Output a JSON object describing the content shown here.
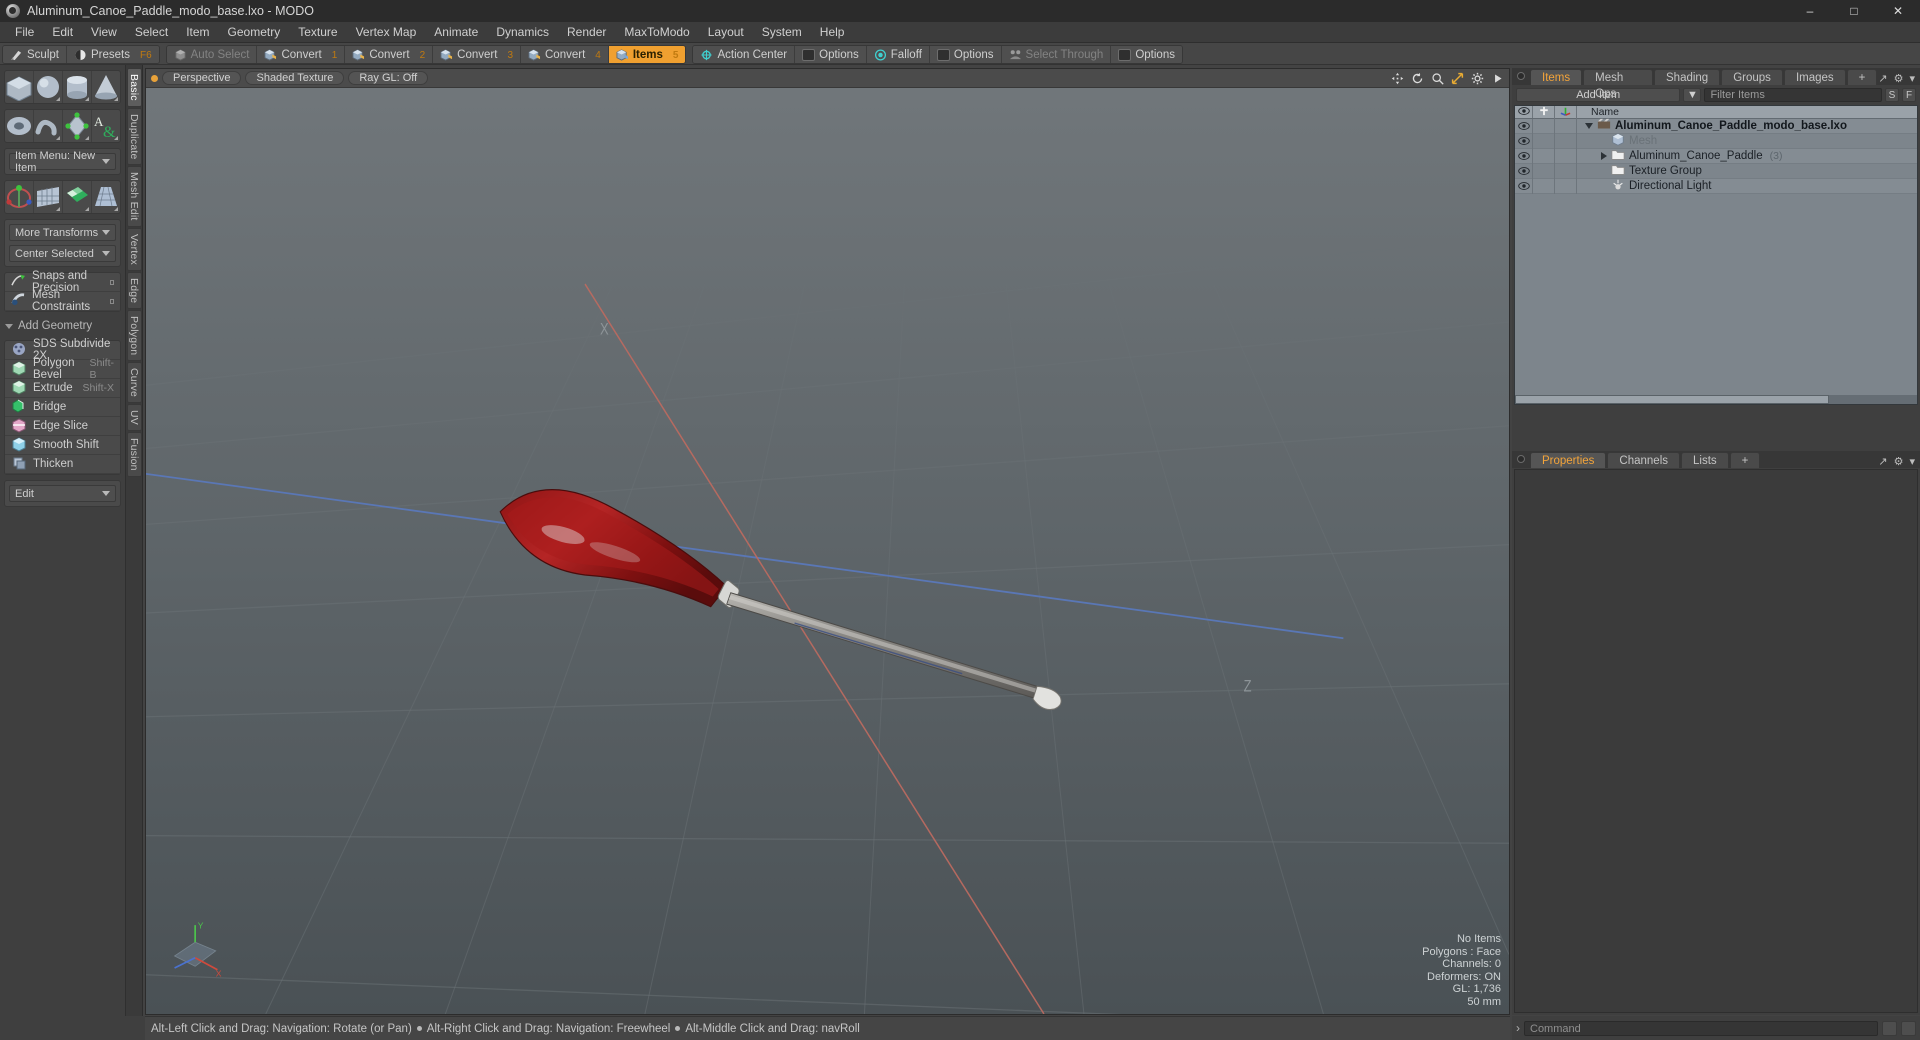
{
  "window": {
    "title": "Aluminum_Canoe_Paddle_modo_base.lxo - MODO",
    "app_icon": "modo-sphere-icon",
    "minimize": "–",
    "maximize": "□",
    "close": "✕"
  },
  "menubar": {
    "items": [
      "File",
      "Edit",
      "View",
      "Select",
      "Item",
      "Geometry",
      "Texture",
      "Vertex Map",
      "Animate",
      "Dynamics",
      "Render",
      "MaxToModo",
      "Layout",
      "System",
      "Help"
    ]
  },
  "toolbar": {
    "left_group": [
      {
        "label": "Sculpt",
        "icon": "brush-icon",
        "shortcut": "",
        "state": "normal"
      },
      {
        "label": "Presets",
        "icon": "sphere-icon",
        "shortcut": "F6",
        "state": "normal"
      }
    ],
    "mode_group": [
      {
        "label": "Auto Select",
        "icon": "cube-grey-icon",
        "shortcut": "",
        "state": "dim"
      },
      {
        "label": "Convert",
        "icon": "cube-vertex-icon",
        "shortcut": "1",
        "state": "normal"
      },
      {
        "label": "Convert",
        "icon": "cube-edge-icon",
        "shortcut": "2",
        "state": "normal"
      },
      {
        "label": "Convert",
        "icon": "cube-polygon-icon",
        "shortcut": "3",
        "state": "normal"
      },
      {
        "label": "Convert",
        "icon": "cube-material-icon",
        "shortcut": "4",
        "state": "normal"
      },
      {
        "label": "Items",
        "icon": "cube-items-icon",
        "shortcut": "5",
        "state": "active"
      }
    ],
    "right_group": [
      {
        "label": "Action Center",
        "icon": "action-center-icon"
      },
      {
        "label": "Options",
        "icon": "options-square-icon"
      },
      {
        "label": "Falloff",
        "icon": "falloff-icon"
      },
      {
        "label": "Options",
        "icon": "options-square-icon"
      },
      {
        "label": "Select Through",
        "icon": "select-through-icon",
        "state": "dim"
      },
      {
        "label": "Options",
        "icon": "options-square-icon"
      }
    ]
  },
  "sidebar": {
    "primitives_row1": [
      {
        "name": "cube-primitive",
        "icon": "cube"
      },
      {
        "name": "sphere-primitive",
        "icon": "sphere"
      },
      {
        "name": "cylinder-primitive",
        "icon": "cylinder"
      },
      {
        "name": "cone-primitive",
        "icon": "cone"
      }
    ],
    "primitives_row2": [
      {
        "name": "torus-primitive",
        "icon": "torus"
      },
      {
        "name": "spiral-primitive",
        "icon": "spiral"
      },
      {
        "name": "pen-primitive",
        "icon": "pen"
      },
      {
        "name": "text-primitive",
        "icon": "text-ampersand"
      }
    ],
    "item_menu": "Item Menu: New Item",
    "transforms_row": [
      {
        "name": "transform-tool",
        "icon": "transform-gizmo"
      },
      {
        "name": "bend-tool",
        "icon": "bend-grid"
      },
      {
        "name": "shear-tool",
        "icon": "shear-checker"
      },
      {
        "name": "taper-tool",
        "icon": "taper-grid"
      }
    ],
    "more_transforms": "More Transforms",
    "center_selected": "Center Selected",
    "snap_rows": [
      {
        "label": "Snaps and Precision",
        "icon": "snap-icon"
      },
      {
        "label": "Mesh Constraints",
        "icon": "constraint-icon"
      }
    ],
    "add_geometry_header": "Add Geometry",
    "geometry_items": [
      {
        "label": "SDS Subdivide 2X",
        "shortcut": "",
        "icon": "sds-icon"
      },
      {
        "label": "Polygon Bevel",
        "shortcut": "Shift-B",
        "icon": "bevel-icon"
      },
      {
        "label": "Extrude",
        "shortcut": "Shift-X",
        "icon": "extrude-icon"
      },
      {
        "label": "Bridge",
        "shortcut": "",
        "icon": "bridge-icon"
      },
      {
        "label": "Edge Slice",
        "shortcut": "",
        "icon": "slice-icon"
      },
      {
        "label": "Smooth Shift",
        "shortcut": "",
        "icon": "smooth-shift-icon"
      },
      {
        "label": "Thicken",
        "shortcut": "",
        "icon": "thicken-icon"
      }
    ],
    "edit_dropdown": "Edit",
    "vertical_tabs": [
      "Basic",
      "Duplicate",
      "Mesh Edit",
      "Vertex",
      "Edge",
      "Polygon",
      "Curve",
      "UV",
      "Fusion"
    ],
    "vertical_tab_selected": "Basic"
  },
  "viewport": {
    "projection": "Perspective",
    "shading": "Shaded Texture",
    "raygl": "Ray GL: Off",
    "tool_icons": [
      "pan-icon",
      "rotate-icon",
      "zoom-icon",
      "fit-icon",
      "gear-icon",
      "play-icon"
    ],
    "stats": {
      "items": "No Items",
      "polygons": "Polygons : Face",
      "channels": "Channels: 0",
      "deformers": "Deformers: ON",
      "gl": "GL: 1,736",
      "grid": "50 mm"
    },
    "axis_labels": {
      "x": "X",
      "y": "Y",
      "z": "Z"
    },
    "colors": {
      "x_axis": "#c06a60",
      "z_axis": "#5a7bbf",
      "bg_top": "#6e7478",
      "bg_bottom": "#4d5458"
    }
  },
  "items_panel": {
    "tabs": [
      "Items",
      "Mesh Ops",
      "Shading",
      "Groups",
      "Images"
    ],
    "selected_tab": "Items",
    "add_tab": "+",
    "add_item_button": "Add Item",
    "add_item_caret": "▼",
    "filter_placeholder": "Filter Items",
    "filter_buttons": [
      "S",
      "F"
    ],
    "columns": [
      "eye-icon",
      "lock-icon",
      "axis-icon",
      "Name"
    ],
    "rows": [
      {
        "name": "Aluminum_Canoe_Paddle_modo_base.lxo",
        "icon": "scene-icon",
        "indent": 0,
        "style": "bold",
        "expander": "down",
        "count": ""
      },
      {
        "name": "Mesh",
        "icon": "mesh-icon",
        "indent": 1,
        "style": "dim",
        "expander": "none",
        "count": ""
      },
      {
        "name": "Aluminum_Canoe_Paddle",
        "icon": "folder-icon",
        "indent": 1,
        "style": "normal",
        "expander": "right",
        "count": "(3)"
      },
      {
        "name": "Texture Group",
        "icon": "folder-icon",
        "indent": 1,
        "style": "normal",
        "expander": "none",
        "count": ""
      },
      {
        "name": "Directional Light",
        "icon": "light-icon",
        "indent": 1,
        "style": "normal",
        "expander": "none",
        "count": ""
      }
    ]
  },
  "properties_panel": {
    "tabs": [
      "Properties",
      "Channels",
      "Lists"
    ],
    "selected_tab": "Properties",
    "add_tab": "+"
  },
  "statusbar": {
    "hints": [
      "Alt-Left Click and Drag: Navigation: Rotate (or Pan)",
      "Alt-Right Click and Drag: Navigation: Freewheel",
      "Alt-Middle Click and Drag: navRoll"
    ]
  },
  "command_bar": {
    "prompt": "›",
    "placeholder": "Command"
  }
}
